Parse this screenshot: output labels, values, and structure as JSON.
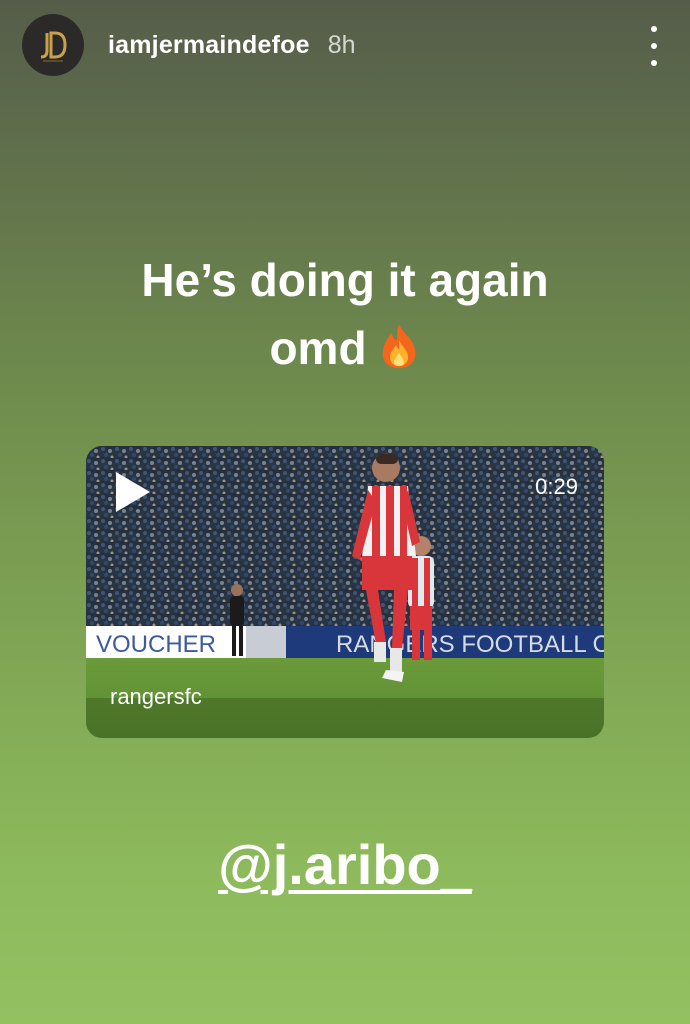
{
  "story": {
    "username": "iamjermaindefoe",
    "time": "8h",
    "avatar_icon": "jd-monogram-logo",
    "more_icon": "more-vertical-icon",
    "caption_line1": "He’s doing it again",
    "caption_line2": "omd",
    "caption_emoji": "fire-icon",
    "mention": "@j.aribo_"
  },
  "video": {
    "duration": "0:29",
    "source": "rangersfc",
    "play_icon": "play-icon",
    "banner_left": "VOUCHER",
    "banner_right": "RANGERS FOOTBALL CL"
  },
  "colors": {
    "background_top": "#555d4a",
    "background_bottom": "#93c162",
    "text": "#ffffff",
    "kit_red": "#d8363a"
  }
}
